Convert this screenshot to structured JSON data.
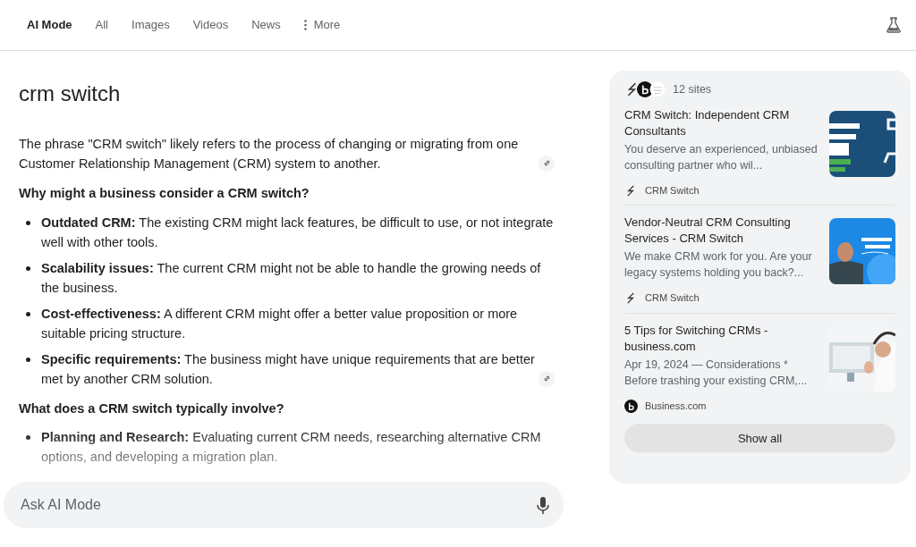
{
  "tabs": [
    {
      "label": "AI Mode",
      "selected": true
    },
    {
      "label": "All",
      "selected": false
    },
    {
      "label": "Images",
      "selected": false
    },
    {
      "label": "Videos",
      "selected": false
    },
    {
      "label": "News",
      "selected": false
    },
    {
      "label": "More",
      "selected": false,
      "kind": "more"
    }
  ],
  "query": "crm switch",
  "answer": [
    {
      "kind": "paragraph",
      "text": "The phrase \"CRM switch\" likely refers to the process of changing or migrating from one Customer Relationship Management (CRM) system to another.",
      "has_link": true
    },
    {
      "kind": "heading",
      "text": "Why might a business consider a CRM switch?"
    },
    {
      "kind": "list",
      "items": [
        {
          "text": "**Outdated CRM:** The existing CRM might lack features, be difficult to use, or not integrate well with other tools.",
          "has_link": false
        },
        {
          "text": "**Scalability issues:** The current CRM might not be able to handle the growing needs of the business.",
          "has_link": false
        },
        {
          "text": "**Cost-effectiveness:** A different CRM might offer a better value proposition or more suitable pricing structure.",
          "has_link": false
        },
        {
          "text": "**Specific requirements:** The business might have unique requirements that are better met by another CRM solution.",
          "has_link": true
        }
      ]
    },
    {
      "kind": "heading",
      "text": "What does a CRM switch typically involve?"
    },
    {
      "kind": "list",
      "items": [
        {
          "text": "**Planning and Research:** Evaluating current CRM needs, researching alternative CRM options, and developing a migration plan.",
          "has_link": false
        }
      ]
    }
  ],
  "ask": {
    "placeholder": "Ask AI Mode"
  },
  "sources": {
    "count": "12 sites",
    "results": [
      {
        "title": "CRM Switch: Independent CRM Consultants",
        "snippet": "You deserve an experienced, unbiased consulting partner who wil...",
        "site": "CRM Switch",
        "kind": "s"
      },
      {
        "title": "Vendor-Neutral CRM Consulting Services - CRM Switch",
        "snippet": "We make CRM work for you. Are your legacy systems holding you back?...",
        "site": "CRM Switch",
        "kind": "s"
      },
      {
        "title": "5 Tips for Switching CRMs - business.com",
        "snippet": "Apr 19, 2024 — Considerations * Before trashing your existing CRM,...",
        "site": "Business.com",
        "kind": "b"
      }
    ],
    "show_all": "Show all"
  }
}
